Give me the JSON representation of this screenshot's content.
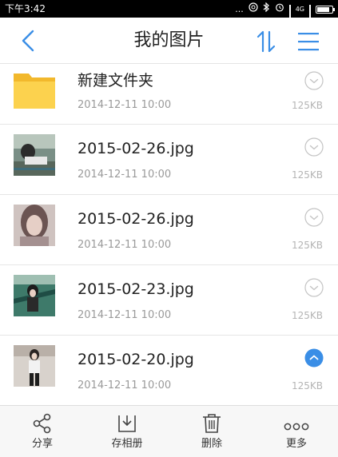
{
  "status_bar": {
    "time": "下午3:42",
    "indicators": [
      "...",
      "⌒",
      "✱",
      "⏰"
    ],
    "network": "4G",
    "icons": [
      "more-dots-icon",
      "nfc-icon",
      "bluetooth-icon",
      "alarm-icon",
      "signal-icon",
      "battery-icon"
    ]
  },
  "nav": {
    "title": "我的图片",
    "back_icon": "chevron-left-icon",
    "sort_icon": "sort-icon",
    "menu_icon": "menu-icon"
  },
  "colors": {
    "accent": "#3a8ee6",
    "folder": "#f7c23a",
    "selected": "#3a8ee6",
    "text": "#222222",
    "meta": "#9a9a9a"
  },
  "files": [
    {
      "type": "folder",
      "name": "新建文件夹",
      "date": "2014-12-11  10:00",
      "size": "125KB",
      "selected": false,
      "thumb_icon": "folder-icon"
    },
    {
      "type": "image",
      "name": "2015-02-26.jpg",
      "date": "2014-12-11  10:00",
      "size": "125KB",
      "selected": false,
      "thumb_icon": "photo-thumbnail"
    },
    {
      "type": "image",
      "name": "2015-02-26.jpg",
      "date": "2014-12-11  10:00",
      "size": "125KB",
      "selected": false,
      "thumb_icon": "photo-thumbnail"
    },
    {
      "type": "image",
      "name": "2015-02-23.jpg",
      "date": "2014-12-11  10:00",
      "size": "125KB",
      "selected": false,
      "thumb_icon": "photo-thumbnail"
    },
    {
      "type": "image",
      "name": "2015-02-20.jpg",
      "date": "2014-12-11  10:00",
      "size": "125KB",
      "selected": true,
      "thumb_icon": "photo-thumbnail"
    }
  ],
  "toolbar": {
    "share_label": "分享",
    "save_album_label": "存相册",
    "delete_label": "删除",
    "more_label": "更多"
  }
}
